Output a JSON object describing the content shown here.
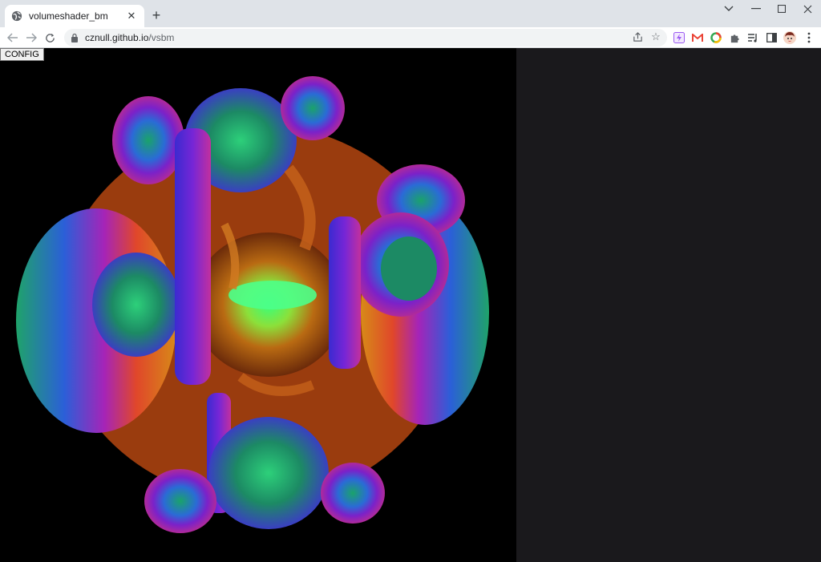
{
  "browser": {
    "tab_title": "volumeshader_bm",
    "url_host": "cznull.github.io",
    "url_path": "/vsbm"
  },
  "page": {
    "config_label": "CONFIG"
  }
}
